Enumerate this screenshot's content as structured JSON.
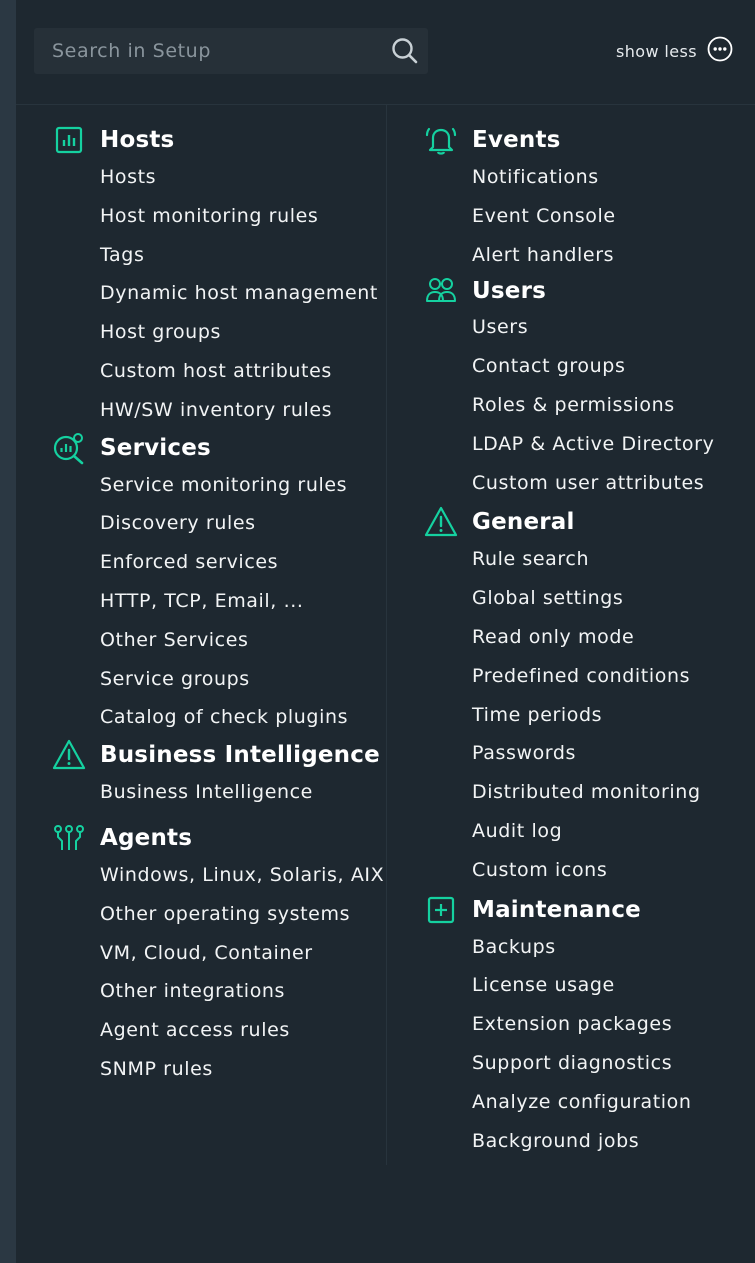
{
  "search": {
    "placeholder": "Search in Setup"
  },
  "toggle": {
    "label": "show less"
  },
  "left_sections": [
    {
      "title": "Hosts",
      "icon": "hosts-icon",
      "items": [
        "Hosts",
        "Host monitoring rules",
        "Tags",
        "Dynamic host management",
        "Host groups",
        "Custom host attributes",
        "HW/SW inventory rules"
      ]
    },
    {
      "title": "Services",
      "icon": "services-icon",
      "items": [
        "Service monitoring rules",
        "Discovery rules",
        "Enforced services",
        "HTTP, TCP, Email, ...",
        "Other Services",
        "Service groups",
        "Catalog of check plugins"
      ]
    },
    {
      "title": "Business Intelligence",
      "icon": "warning-triangle-icon",
      "items": [
        "Business Intelligence"
      ]
    },
    {
      "title": "Agents",
      "icon": "agents-icon",
      "items": [
        "Windows, Linux, Solaris, AIX",
        "Other operating systems",
        "VM, Cloud, Container",
        "Other integrations",
        "Agent access rules",
        "SNMP rules"
      ]
    }
  ],
  "right_sections": [
    {
      "title": "Events",
      "icon": "bell-icon",
      "items": [
        "Notifications",
        "Event Console",
        "Alert handlers"
      ]
    },
    {
      "title": "Users",
      "icon": "users-icon",
      "items": [
        "Users",
        "Contact groups",
        "Roles & permissions",
        "LDAP & Active Directory",
        "Custom user attributes"
      ]
    },
    {
      "title": "General",
      "icon": "warning-triangle-icon",
      "items": [
        "Rule search",
        "Global settings",
        "Read only mode",
        "Predefined conditions",
        "Time periods",
        "Passwords",
        "Distributed monitoring",
        "Audit log",
        "Custom icons"
      ]
    },
    {
      "title": "Maintenance",
      "icon": "plus-square-icon",
      "items": [
        "Backups",
        "License usage",
        "Extension packages",
        "Support diagnostics",
        "Analyze configuration",
        "Background jobs"
      ]
    }
  ],
  "colors": {
    "accent": "#15d1a0",
    "background": "#1e2830",
    "text": "#f2f4f5"
  }
}
